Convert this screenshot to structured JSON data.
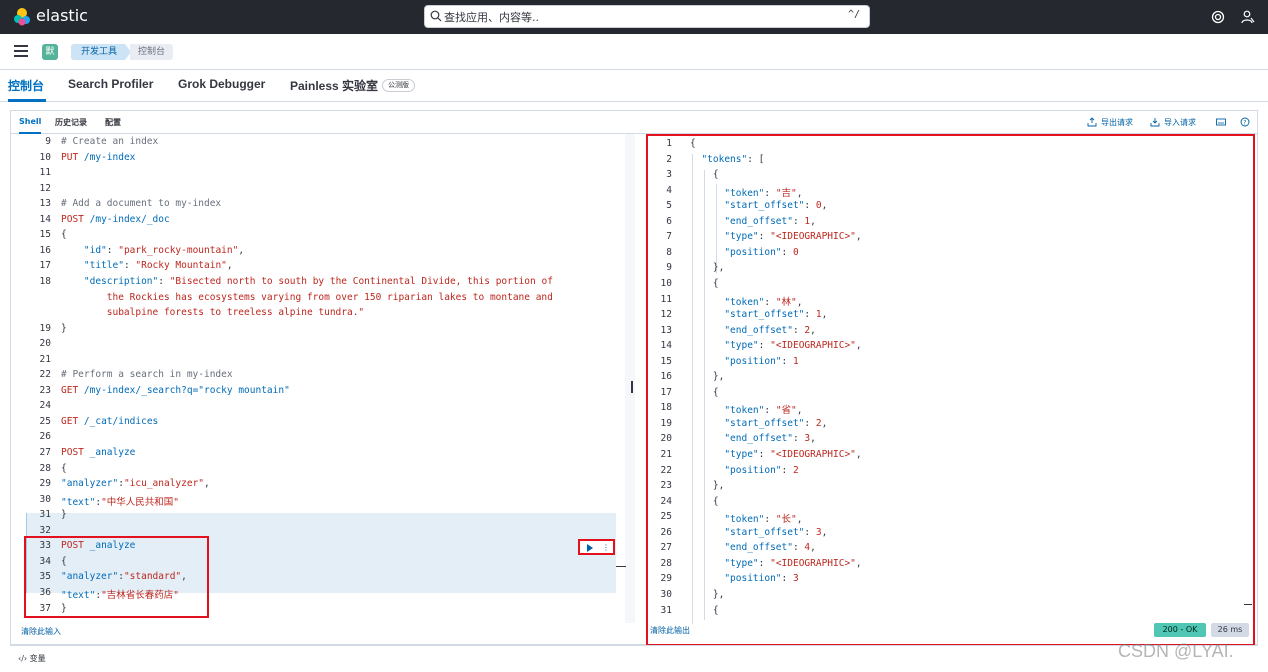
{
  "header": {
    "brand": "elastic",
    "search_placeholder": "查找应用、内容等..",
    "search_shortcut": "^/"
  },
  "breadcrumb": {
    "space": "默",
    "crumbs": [
      "开发工具",
      "控制台"
    ]
  },
  "app_tabs": {
    "console": "控制台",
    "search_profiler": "Search Profiler",
    "grok_debugger": "Grok Debugger",
    "painless": "Painless 实验室",
    "beta": "公测版"
  },
  "panel": {
    "tabs": [
      "Shell",
      "历史记录",
      "配置"
    ],
    "export": "导出请求",
    "import": "导入请求",
    "clear_input": "清除此输入",
    "clear_output": "清除此输出",
    "status": "200 - OK",
    "duration": "26 ms",
    "variables": "变量"
  },
  "editor_lines": [
    {
      "n": "9",
      "parts": [
        [
          "c-comment",
          "# Create an index"
        ]
      ]
    },
    {
      "n": "10",
      "parts": [
        [
          "c-method",
          "PUT"
        ],
        [
          "c-plain",
          " "
        ],
        [
          "c-path",
          "/my-index"
        ]
      ]
    },
    {
      "n": "11",
      "parts": []
    },
    {
      "n": "12",
      "parts": []
    },
    {
      "n": "13",
      "parts": [
        [
          "c-comment",
          "# Add a document to my-index"
        ]
      ]
    },
    {
      "n": "14",
      "parts": [
        [
          "c-method",
          "POST"
        ],
        [
          "c-plain",
          " "
        ],
        [
          "c-path",
          "/my-index/_doc"
        ]
      ]
    },
    {
      "n": "15",
      "parts": [
        [
          "c-plain",
          "{"
        ]
      ]
    },
    {
      "n": "16",
      "parts": [
        [
          "c-plain",
          "    "
        ],
        [
          "c-key",
          "\"id\""
        ],
        [
          "c-plain",
          ": "
        ],
        [
          "c-str",
          "\"park_rocky-mountain\""
        ],
        [
          "c-plain",
          ","
        ]
      ]
    },
    {
      "n": "17",
      "parts": [
        [
          "c-plain",
          "    "
        ],
        [
          "c-key",
          "\"title\""
        ],
        [
          "c-plain",
          ": "
        ],
        [
          "c-str",
          "\"Rocky Mountain\""
        ],
        [
          "c-plain",
          ","
        ]
      ]
    },
    {
      "n": "18",
      "parts": [
        [
          "c-plain",
          "    "
        ],
        [
          "c-key",
          "\"description\""
        ],
        [
          "c-plain",
          ": "
        ],
        [
          "c-str",
          "\"Bisected north to south by the Continental Divide, this portion of"
        ]
      ]
    },
    {
      "n": "",
      "parts": [
        [
          "c-str",
          "        the Rockies has ecosystems varying from over 150 riparian lakes to montane and"
        ]
      ]
    },
    {
      "n": "",
      "parts": [
        [
          "c-str",
          "        subalpine forests to treeless alpine tundra.\""
        ]
      ]
    },
    {
      "n": "19",
      "parts": [
        [
          "c-plain",
          "}"
        ]
      ]
    },
    {
      "n": "20",
      "parts": []
    },
    {
      "n": "21",
      "parts": []
    },
    {
      "n": "22",
      "parts": [
        [
          "c-comment",
          "# Perform a search in my-index"
        ]
      ]
    },
    {
      "n": "23",
      "parts": [
        [
          "c-method",
          "GET"
        ],
        [
          "c-plain",
          " "
        ],
        [
          "c-path",
          "/my-index/_search?q=\"rocky mountain\""
        ]
      ]
    },
    {
      "n": "24",
      "parts": []
    },
    {
      "n": "25",
      "parts": [
        [
          "c-method",
          "GET"
        ],
        [
          "c-plain",
          " "
        ],
        [
          "c-path",
          "/_cat/indices"
        ]
      ]
    },
    {
      "n": "26",
      "parts": []
    },
    {
      "n": "27",
      "parts": [
        [
          "c-method",
          "POST"
        ],
        [
          "c-plain",
          " "
        ],
        [
          "c-path",
          "_analyze"
        ]
      ]
    },
    {
      "n": "28",
      "parts": [
        [
          "c-plain",
          "{"
        ]
      ]
    },
    {
      "n": "29",
      "parts": [
        [
          "c-key",
          "\"analyzer\""
        ],
        [
          "c-plain",
          ":"
        ],
        [
          "c-str",
          "\"icu_analyzer\""
        ],
        [
          "c-plain",
          ","
        ]
      ]
    },
    {
      "n": "30",
      "parts": [
        [
          "c-key",
          "\"text\""
        ],
        [
          "c-plain",
          ":"
        ],
        [
          "c-str",
          "\"中华人民共和国\""
        ]
      ]
    },
    {
      "n": "31",
      "parts": [
        [
          "c-plain",
          "}"
        ]
      ]
    },
    {
      "n": "32",
      "parts": []
    },
    {
      "n": "33",
      "parts": [
        [
          "c-method",
          "POST"
        ],
        [
          "c-plain",
          " "
        ],
        [
          "c-path",
          "_analyze"
        ]
      ]
    },
    {
      "n": "34",
      "parts": [
        [
          "c-plain",
          "{"
        ]
      ]
    },
    {
      "n": "35",
      "parts": [
        [
          "c-key",
          "\"analyzer\""
        ],
        [
          "c-plain",
          ":"
        ],
        [
          "c-str",
          "\"standard\""
        ],
        [
          "c-plain",
          ","
        ]
      ]
    },
    {
      "n": "36",
      "parts": [
        [
          "c-key",
          "\"text\""
        ],
        [
          "c-plain",
          ":"
        ],
        [
          "c-str",
          "\"吉林省长春药店\""
        ]
      ]
    },
    {
      "n": "37",
      "parts": [
        [
          "c-plain",
          "}"
        ]
      ]
    }
  ],
  "output_lines": [
    {
      "n": "1",
      "parts": [
        [
          "c-plain",
          "{"
        ]
      ]
    },
    {
      "n": "2",
      "parts": [
        [
          "c-plain",
          "  "
        ],
        [
          "c-key",
          "\"tokens\""
        ],
        [
          "c-plain",
          ": ["
        ]
      ]
    },
    {
      "n": "3",
      "parts": [
        [
          "c-plain",
          "    {"
        ]
      ]
    },
    {
      "n": "4",
      "parts": [
        [
          "c-plain",
          "      "
        ],
        [
          "c-key",
          "\"token\""
        ],
        [
          "c-plain",
          ": "
        ],
        [
          "c-str",
          "\"吉\""
        ],
        [
          "c-plain",
          ","
        ]
      ]
    },
    {
      "n": "5",
      "parts": [
        [
          "c-plain",
          "      "
        ],
        [
          "c-key",
          "\"start_offset\""
        ],
        [
          "c-plain",
          ": "
        ],
        [
          "c-num",
          "0"
        ],
        [
          "c-plain",
          ","
        ]
      ]
    },
    {
      "n": "6",
      "parts": [
        [
          "c-plain",
          "      "
        ],
        [
          "c-key",
          "\"end_offset\""
        ],
        [
          "c-plain",
          ": "
        ],
        [
          "c-num",
          "1"
        ],
        [
          "c-plain",
          ","
        ]
      ]
    },
    {
      "n": "7",
      "parts": [
        [
          "c-plain",
          "      "
        ],
        [
          "c-key",
          "\"type\""
        ],
        [
          "c-plain",
          ": "
        ],
        [
          "c-str",
          "\"<IDEOGRAPHIC>\""
        ],
        [
          "c-plain",
          ","
        ]
      ]
    },
    {
      "n": "8",
      "parts": [
        [
          "c-plain",
          "      "
        ],
        [
          "c-key",
          "\"position\""
        ],
        [
          "c-plain",
          ": "
        ],
        [
          "c-num",
          "0"
        ]
      ]
    },
    {
      "n": "9",
      "parts": [
        [
          "c-plain",
          "    },"
        ]
      ]
    },
    {
      "n": "10",
      "parts": [
        [
          "c-plain",
          "    {"
        ]
      ]
    },
    {
      "n": "11",
      "parts": [
        [
          "c-plain",
          "      "
        ],
        [
          "c-key",
          "\"token\""
        ],
        [
          "c-plain",
          ": "
        ],
        [
          "c-str",
          "\"林\""
        ],
        [
          "c-plain",
          ","
        ]
      ]
    },
    {
      "n": "12",
      "parts": [
        [
          "c-plain",
          "      "
        ],
        [
          "c-key",
          "\"start_offset\""
        ],
        [
          "c-plain",
          ": "
        ],
        [
          "c-num",
          "1"
        ],
        [
          "c-plain",
          ","
        ]
      ]
    },
    {
      "n": "13",
      "parts": [
        [
          "c-plain",
          "      "
        ],
        [
          "c-key",
          "\"end_offset\""
        ],
        [
          "c-plain",
          ": "
        ],
        [
          "c-num",
          "2"
        ],
        [
          "c-plain",
          ","
        ]
      ]
    },
    {
      "n": "14",
      "parts": [
        [
          "c-plain",
          "      "
        ],
        [
          "c-key",
          "\"type\""
        ],
        [
          "c-plain",
          ": "
        ],
        [
          "c-str",
          "\"<IDEOGRAPHIC>\""
        ],
        [
          "c-plain",
          ","
        ]
      ]
    },
    {
      "n": "15",
      "parts": [
        [
          "c-plain",
          "      "
        ],
        [
          "c-key",
          "\"position\""
        ],
        [
          "c-plain",
          ": "
        ],
        [
          "c-num",
          "1"
        ]
      ]
    },
    {
      "n": "16",
      "parts": [
        [
          "c-plain",
          "    },"
        ]
      ]
    },
    {
      "n": "17",
      "parts": [
        [
          "c-plain",
          "    {"
        ]
      ]
    },
    {
      "n": "18",
      "parts": [
        [
          "c-plain",
          "      "
        ],
        [
          "c-key",
          "\"token\""
        ],
        [
          "c-plain",
          ": "
        ],
        [
          "c-str",
          "\"省\""
        ],
        [
          "c-plain",
          ","
        ]
      ]
    },
    {
      "n": "19",
      "parts": [
        [
          "c-plain",
          "      "
        ],
        [
          "c-key",
          "\"start_offset\""
        ],
        [
          "c-plain",
          ": "
        ],
        [
          "c-num",
          "2"
        ],
        [
          "c-plain",
          ","
        ]
      ]
    },
    {
      "n": "20",
      "parts": [
        [
          "c-plain",
          "      "
        ],
        [
          "c-key",
          "\"end_offset\""
        ],
        [
          "c-plain",
          ": "
        ],
        [
          "c-num",
          "3"
        ],
        [
          "c-plain",
          ","
        ]
      ]
    },
    {
      "n": "21",
      "parts": [
        [
          "c-plain",
          "      "
        ],
        [
          "c-key",
          "\"type\""
        ],
        [
          "c-plain",
          ": "
        ],
        [
          "c-str",
          "\"<IDEOGRAPHIC>\""
        ],
        [
          "c-plain",
          ","
        ]
      ]
    },
    {
      "n": "22",
      "parts": [
        [
          "c-plain",
          "      "
        ],
        [
          "c-key",
          "\"position\""
        ],
        [
          "c-plain",
          ": "
        ],
        [
          "c-num",
          "2"
        ]
      ]
    },
    {
      "n": "23",
      "parts": [
        [
          "c-plain",
          "    },"
        ]
      ]
    },
    {
      "n": "24",
      "parts": [
        [
          "c-plain",
          "    {"
        ]
      ]
    },
    {
      "n": "25",
      "parts": [
        [
          "c-plain",
          "      "
        ],
        [
          "c-key",
          "\"token\""
        ],
        [
          "c-plain",
          ": "
        ],
        [
          "c-str",
          "\"长\""
        ],
        [
          "c-plain",
          ","
        ]
      ]
    },
    {
      "n": "26",
      "parts": [
        [
          "c-plain",
          "      "
        ],
        [
          "c-key",
          "\"start_offset\""
        ],
        [
          "c-plain",
          ": "
        ],
        [
          "c-num",
          "3"
        ],
        [
          "c-plain",
          ","
        ]
      ]
    },
    {
      "n": "27",
      "parts": [
        [
          "c-plain",
          "      "
        ],
        [
          "c-key",
          "\"end_offset\""
        ],
        [
          "c-plain",
          ": "
        ],
        [
          "c-num",
          "4"
        ],
        [
          "c-plain",
          ","
        ]
      ]
    },
    {
      "n": "28",
      "parts": [
        [
          "c-plain",
          "      "
        ],
        [
          "c-key",
          "\"type\""
        ],
        [
          "c-plain",
          ": "
        ],
        [
          "c-str",
          "\"<IDEOGRAPHIC>\""
        ],
        [
          "c-plain",
          ","
        ]
      ]
    },
    {
      "n": "29",
      "parts": [
        [
          "c-plain",
          "      "
        ],
        [
          "c-key",
          "\"position\""
        ],
        [
          "c-plain",
          ": "
        ],
        [
          "c-num",
          "3"
        ]
      ]
    },
    {
      "n": "30",
      "parts": [
        [
          "c-plain",
          "    },"
        ]
      ]
    },
    {
      "n": "31",
      "parts": [
        [
          "c-plain",
          "    {"
        ]
      ]
    }
  ],
  "watermark": "CSDN @LYAI."
}
